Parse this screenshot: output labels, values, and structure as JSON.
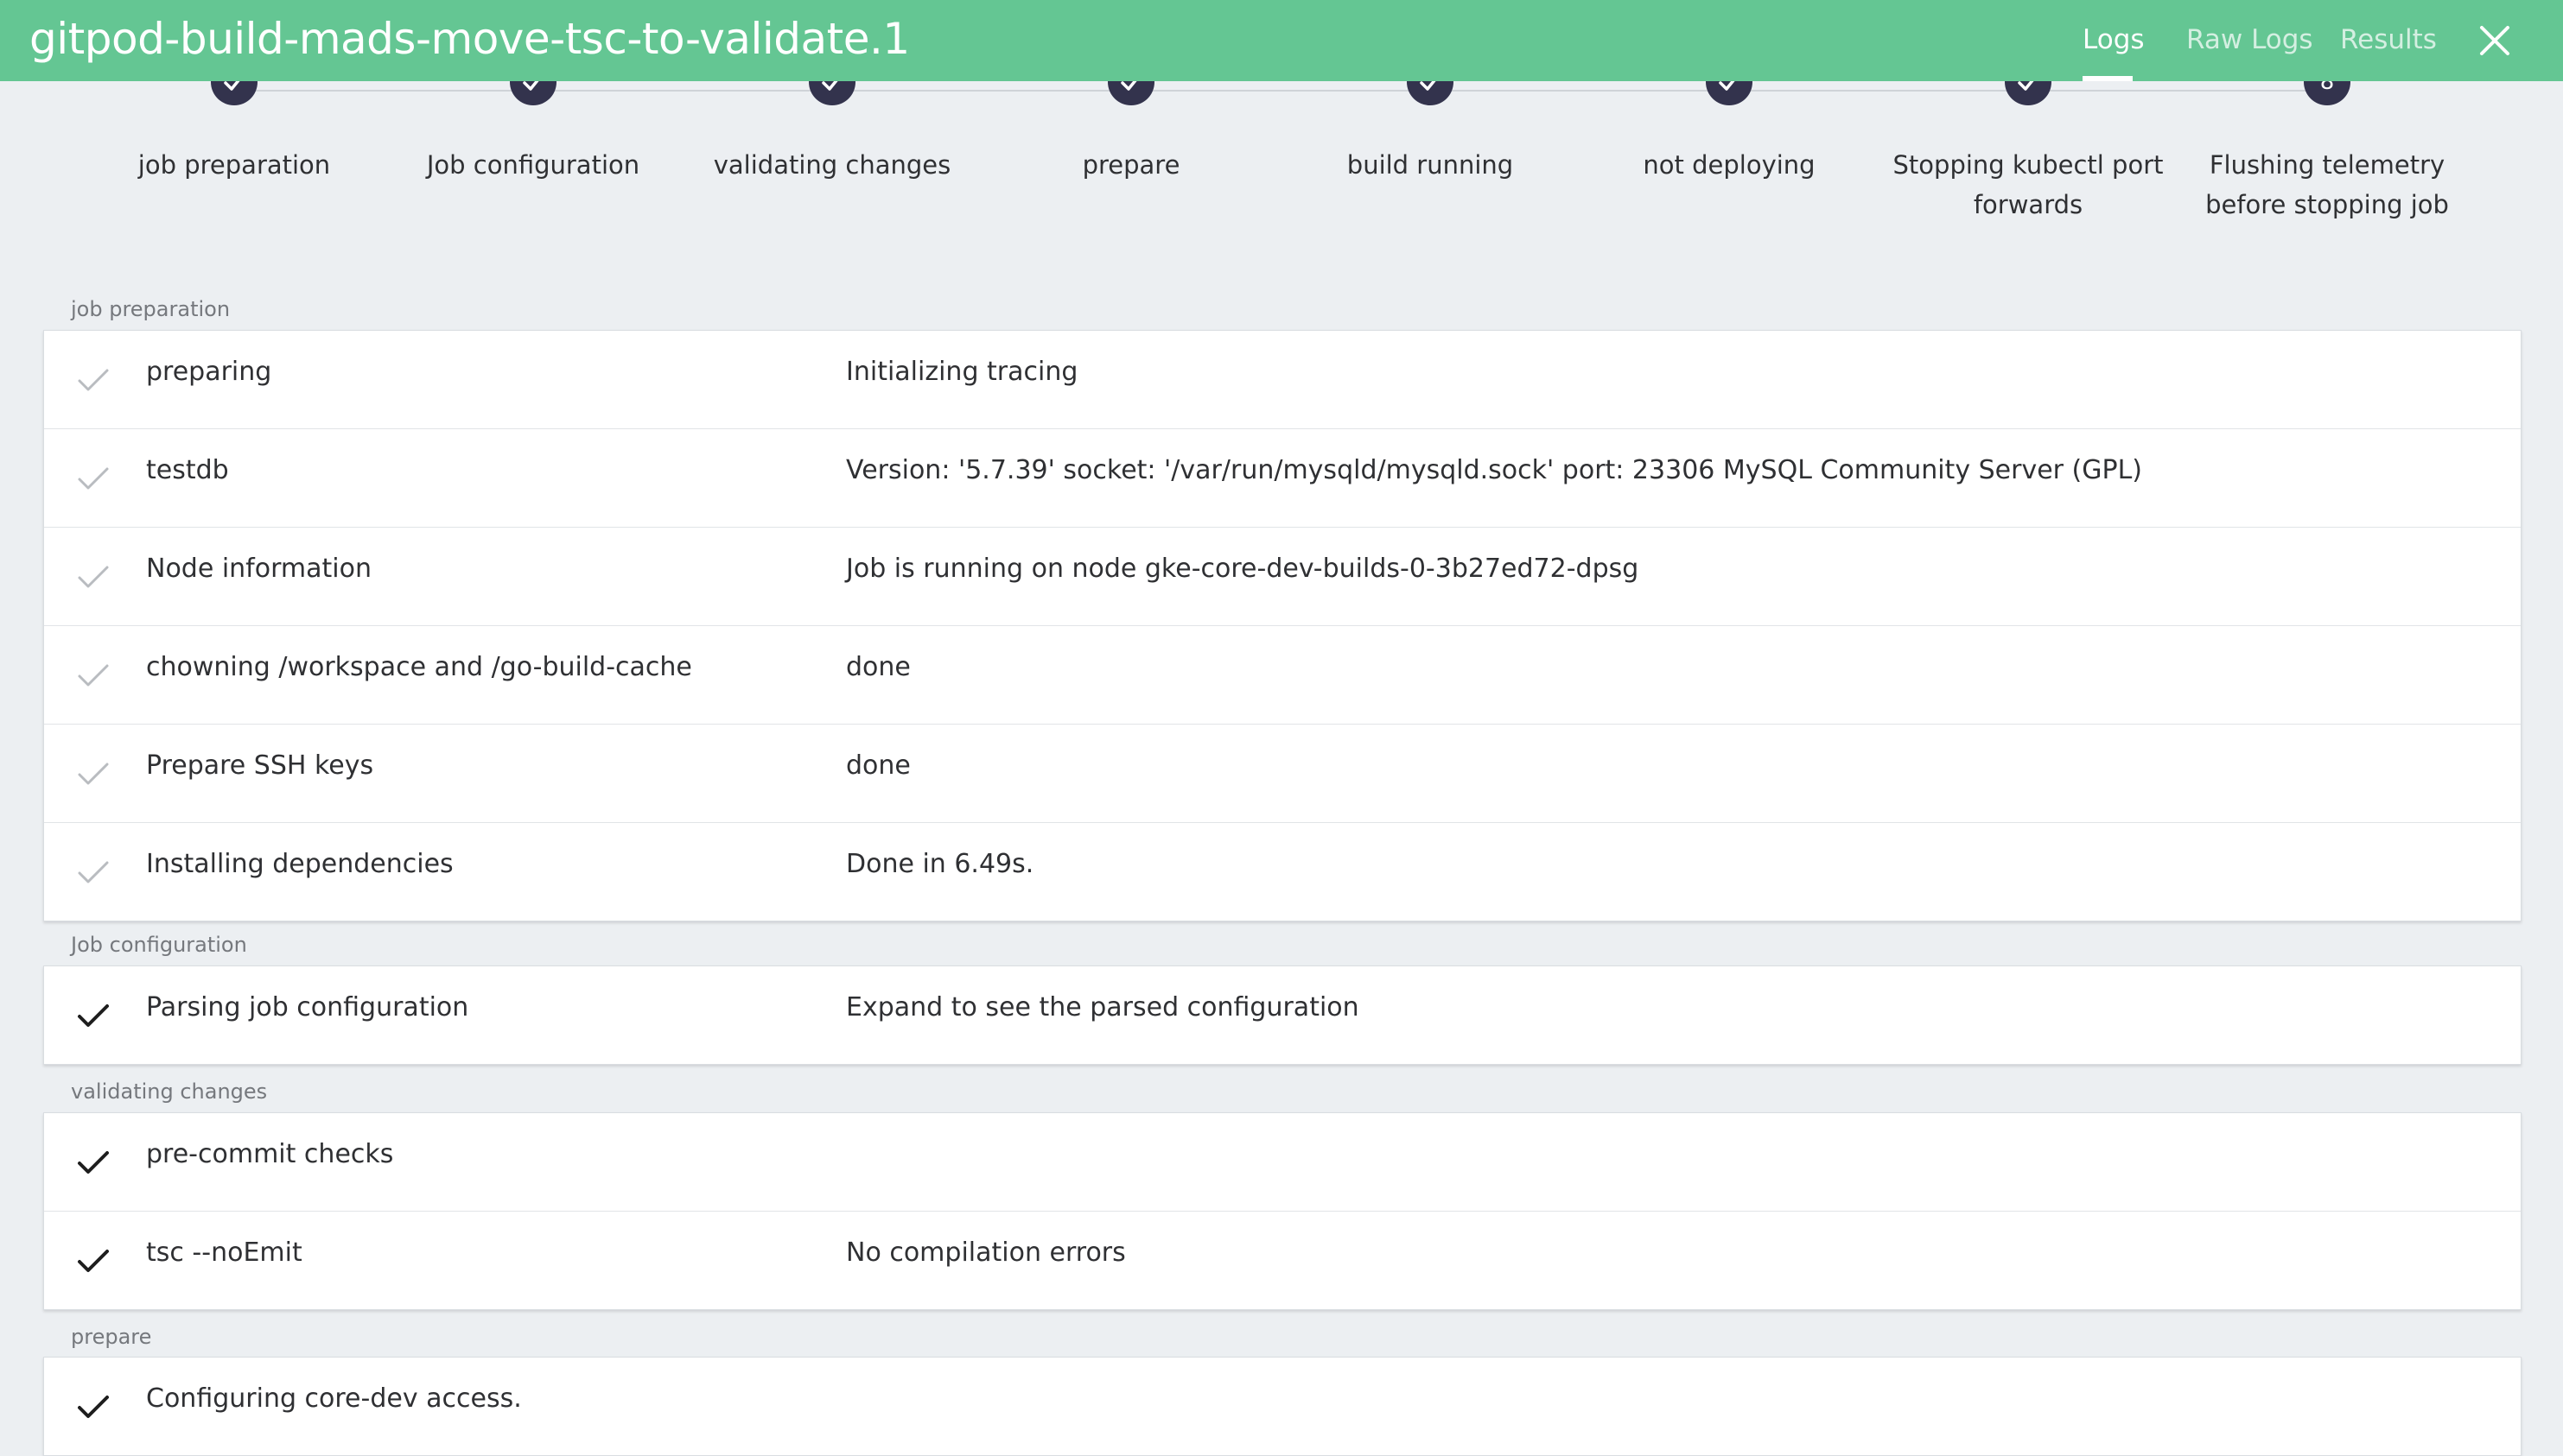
{
  "header": {
    "title": "gitpod-build-mads-move-tsc-to-validate.1",
    "tabs": [
      {
        "label": "Logs",
        "active": true
      },
      {
        "label": "Raw Logs",
        "active": false
      },
      {
        "label": "Results",
        "active": false
      }
    ],
    "close_icon": "close-icon"
  },
  "stepper": {
    "steps": [
      {
        "label": "job preparation",
        "status": "done"
      },
      {
        "label": "Job configuration",
        "status": "done"
      },
      {
        "label": "validating changes",
        "status": "done"
      },
      {
        "label": "prepare",
        "status": "done"
      },
      {
        "label": "build running",
        "status": "done"
      },
      {
        "label": "not deploying",
        "status": "done"
      },
      {
        "label": "Stopping kubectl port forwards",
        "status": "done"
      },
      {
        "label": "Flushing telemetry before stopping job",
        "status": "number",
        "number": "8"
      }
    ]
  },
  "sections": [
    {
      "label": "job preparation",
      "rows": [
        {
          "name": "preparing",
          "value": "Initializing tracing",
          "check": "light"
        },
        {
          "name": "testdb",
          "value": "Version: '5.7.39' socket: '/var/run/mysqld/mysqld.sock' port: 23306 MySQL Community Server (GPL)",
          "check": "light"
        },
        {
          "name": "Node information",
          "value": "Job is running on node gke-core-dev-builds-0-3b27ed72-dpsg",
          "check": "light"
        },
        {
          "name": "chowning /workspace and /go-build-cache",
          "value": "done",
          "check": "light"
        },
        {
          "name": "Prepare SSH keys",
          "value": "done",
          "check": "light"
        },
        {
          "name": "Installing dependencies",
          "value": "Done in 6.49s.",
          "check": "light"
        }
      ]
    },
    {
      "label": "Job configuration",
      "rows": [
        {
          "name": "Parsing job configuration",
          "value": "Expand to see the parsed configuration",
          "check": "dark"
        }
      ]
    },
    {
      "label": "validating changes",
      "rows": [
        {
          "name": "pre-commit checks",
          "value": "",
          "check": "dark"
        },
        {
          "name": "tsc --noEmit",
          "value": "No compilation errors",
          "check": "dark"
        }
      ]
    },
    {
      "label": "prepare",
      "rows": [
        {
          "name": "Configuring core-dev access.",
          "value": "",
          "check": "dark"
        }
      ]
    }
  ],
  "colors": {
    "header_bg": "#64c693",
    "step_circle": "#33334d",
    "page_bg": "#eceff2",
    "check_light": "#b9bcc0",
    "check_dark": "#1e1e1e"
  }
}
